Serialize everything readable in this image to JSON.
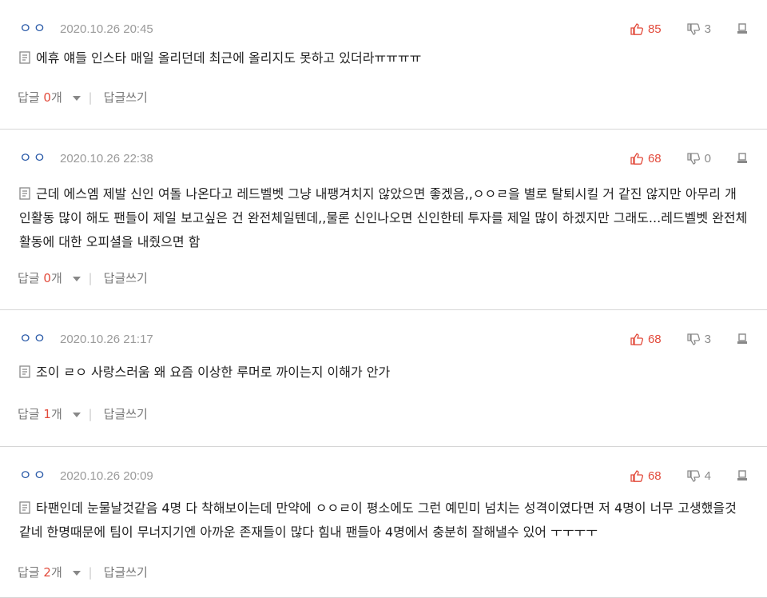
{
  "comments": [
    {
      "user": "ㅇㅇ",
      "time": "2020.10.26 20:45",
      "up": "85",
      "down": "3",
      "text": "에휴 얘들 인스타 매일 올리던데 최근에 올리지도 못하고 있더라ㅠㅠㅠㅠ",
      "reply_label": "답글",
      "reply_count": "0",
      "reply_unit": "개",
      "write_label": "답글쓰기"
    },
    {
      "user": "ㅇㅇ",
      "time": "2020.10.26 22:38",
      "up": "68",
      "down": "0",
      "text": "근데 에스엠 제발 신인 여돌 나온다고 레드벨벳 그냥 내팽겨치지 않았으면 좋겠음,,ㅇㅇㄹ을 별로 탈퇴시킬 거 같진 않지만 아무리 개인활동 많이 해도 팬들이 제일 보고싶은 건 완전체일텐데,,물론 신인나오면 신인한테 투자를 제일 많이 하겠지만 그래도...레드벨벳 완전체 활동에 대한 오피셜을 내줬으면 함",
      "reply_label": "답글",
      "reply_count": "0",
      "reply_unit": "개",
      "write_label": "답글쓰기"
    },
    {
      "user": "ㅇㅇ",
      "time": "2020.10.26 21:17",
      "up": "68",
      "down": "3",
      "text": "조이 ㄹㅇ 사랑스러움 왜 요즘 이상한 루머로 까이는지 이해가 안가",
      "reply_label": "답글",
      "reply_count": "1",
      "reply_unit": "개",
      "write_label": "답글쓰기"
    },
    {
      "user": "ㅇㅇ",
      "time": "2020.10.26 20:09",
      "up": "68",
      "down": "4",
      "text": "타팬인데 눈물날것같음 4명 다 착해보이는데 만약에 ㅇㅇㄹ이 평소에도 그런 예민미 넘치는 성격이였다면 저 4명이 너무 고생했을것 같네 한명때문에 팀이 무너지기엔 아까운 존재들이 많다 힘내 팬들아 4명에서 충분히 잘해낼수 있어 ㅜㅜㅜㅜ",
      "reply_label": "답글",
      "reply_count": "2",
      "reply_unit": "개",
      "write_label": "답글쓰기"
    }
  ],
  "icons": {
    "up": "thumbs-up-icon",
    "down": "thumbs-down-icon",
    "report": "report-icon",
    "memo": "memo-icon"
  },
  "colors": {
    "user": "#2a5aa8",
    "upvote": "#e24a3b",
    "reply_count": "#e24a3b",
    "divider": "#d6d6d6"
  }
}
